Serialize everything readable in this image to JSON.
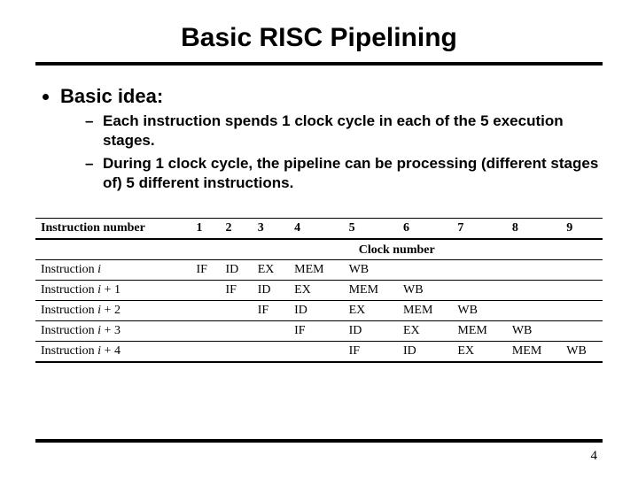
{
  "title": "Basic RISC Pipelining",
  "bullets": {
    "main": "Basic idea:",
    "sub": [
      "Each instruction spends 1 clock cycle in each of the 5 execution stages.",
      "During 1 clock cycle, the pipeline can be processing (different stages of) 5 different instructions."
    ]
  },
  "table": {
    "superheader": "Clock number",
    "col_header_label": "Instruction number",
    "cols": [
      "1",
      "2",
      "3",
      "4",
      "5",
      "6",
      "7",
      "8",
      "9"
    ],
    "rows": [
      {
        "label_prefix": "Instruction ",
        "label_var": "i",
        "label_suffix": "",
        "cells": [
          "IF",
          "ID",
          "EX",
          "MEM",
          "WB",
          "",
          "",
          "",
          ""
        ]
      },
      {
        "label_prefix": "Instruction ",
        "label_var": "i",
        "label_suffix": " + 1",
        "cells": [
          "",
          "IF",
          "ID",
          "EX",
          "MEM",
          "WB",
          "",
          "",
          ""
        ]
      },
      {
        "label_prefix": "Instruction ",
        "label_var": "i",
        "label_suffix": " + 2",
        "cells": [
          "",
          "",
          "IF",
          "ID",
          "EX",
          "MEM",
          "WB",
          "",
          ""
        ]
      },
      {
        "label_prefix": "Instruction ",
        "label_var": "i",
        "label_suffix": " + 3",
        "cells": [
          "",
          "",
          "",
          "IF",
          "ID",
          "EX",
          "MEM",
          "WB",
          ""
        ]
      },
      {
        "label_prefix": "Instruction ",
        "label_var": "i",
        "label_suffix": " + 4",
        "cells": [
          "",
          "",
          "",
          "",
          "IF",
          "ID",
          "EX",
          "MEM",
          "WB"
        ]
      }
    ]
  },
  "page_number": "4"
}
